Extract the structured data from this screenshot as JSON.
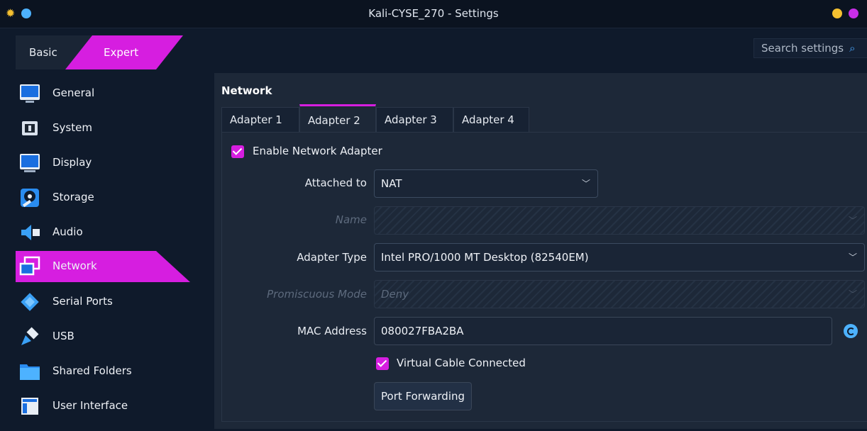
{
  "window": {
    "title": "Kali-CYSE_270 - Settings",
    "dot_colors": [
      "#f5c030",
      "#4db2ff",
      "#f5c030",
      "#c82ee8"
    ]
  },
  "toolbar": {
    "mode_basic": "Basic",
    "mode_expert": "Expert",
    "search_placeholder": "Search settings"
  },
  "sidebar": {
    "items": [
      {
        "label": "General",
        "icon": "monitor-icon"
      },
      {
        "label": "System",
        "icon": "chip-icon"
      },
      {
        "label": "Display",
        "icon": "display-icon"
      },
      {
        "label": "Storage",
        "icon": "disc-icon"
      },
      {
        "label": "Audio",
        "icon": "speaker-icon"
      },
      {
        "label": "Network",
        "icon": "network-icon",
        "active": true
      },
      {
        "label": "Serial Ports",
        "icon": "serial-port-icon"
      },
      {
        "label": "USB",
        "icon": "usb-icon"
      },
      {
        "label": "Shared Folders",
        "icon": "folder-icon"
      },
      {
        "label": "User Interface",
        "icon": "window-icon"
      }
    ]
  },
  "network": {
    "title": "Network",
    "tabs": [
      "Adapter 1",
      "Adapter 2",
      "Adapter 3",
      "Adapter 4"
    ],
    "active_tab": "Adapter 2",
    "enable_adapter_label": "Enable Network Adapter",
    "attached_to_label": "Attached to",
    "attached_to_value": "NAT",
    "name_label": "Name",
    "adapter_type_label": "Adapter Type",
    "adapter_type_value": "Intel PRO/1000 MT Desktop (82540EM)",
    "promiscuous_label": "Promiscuous Mode",
    "promiscuous_value": "Deny",
    "mac_label": "MAC Address",
    "mac_value": "080027FBA2BA",
    "cable_connected_label": "Virtual Cable Connected",
    "port_forwarding_label": "Port Forwarding"
  },
  "colors": {
    "accent": "#d61ee0",
    "background": "#0f1a2b",
    "panel": "#1d2838"
  }
}
